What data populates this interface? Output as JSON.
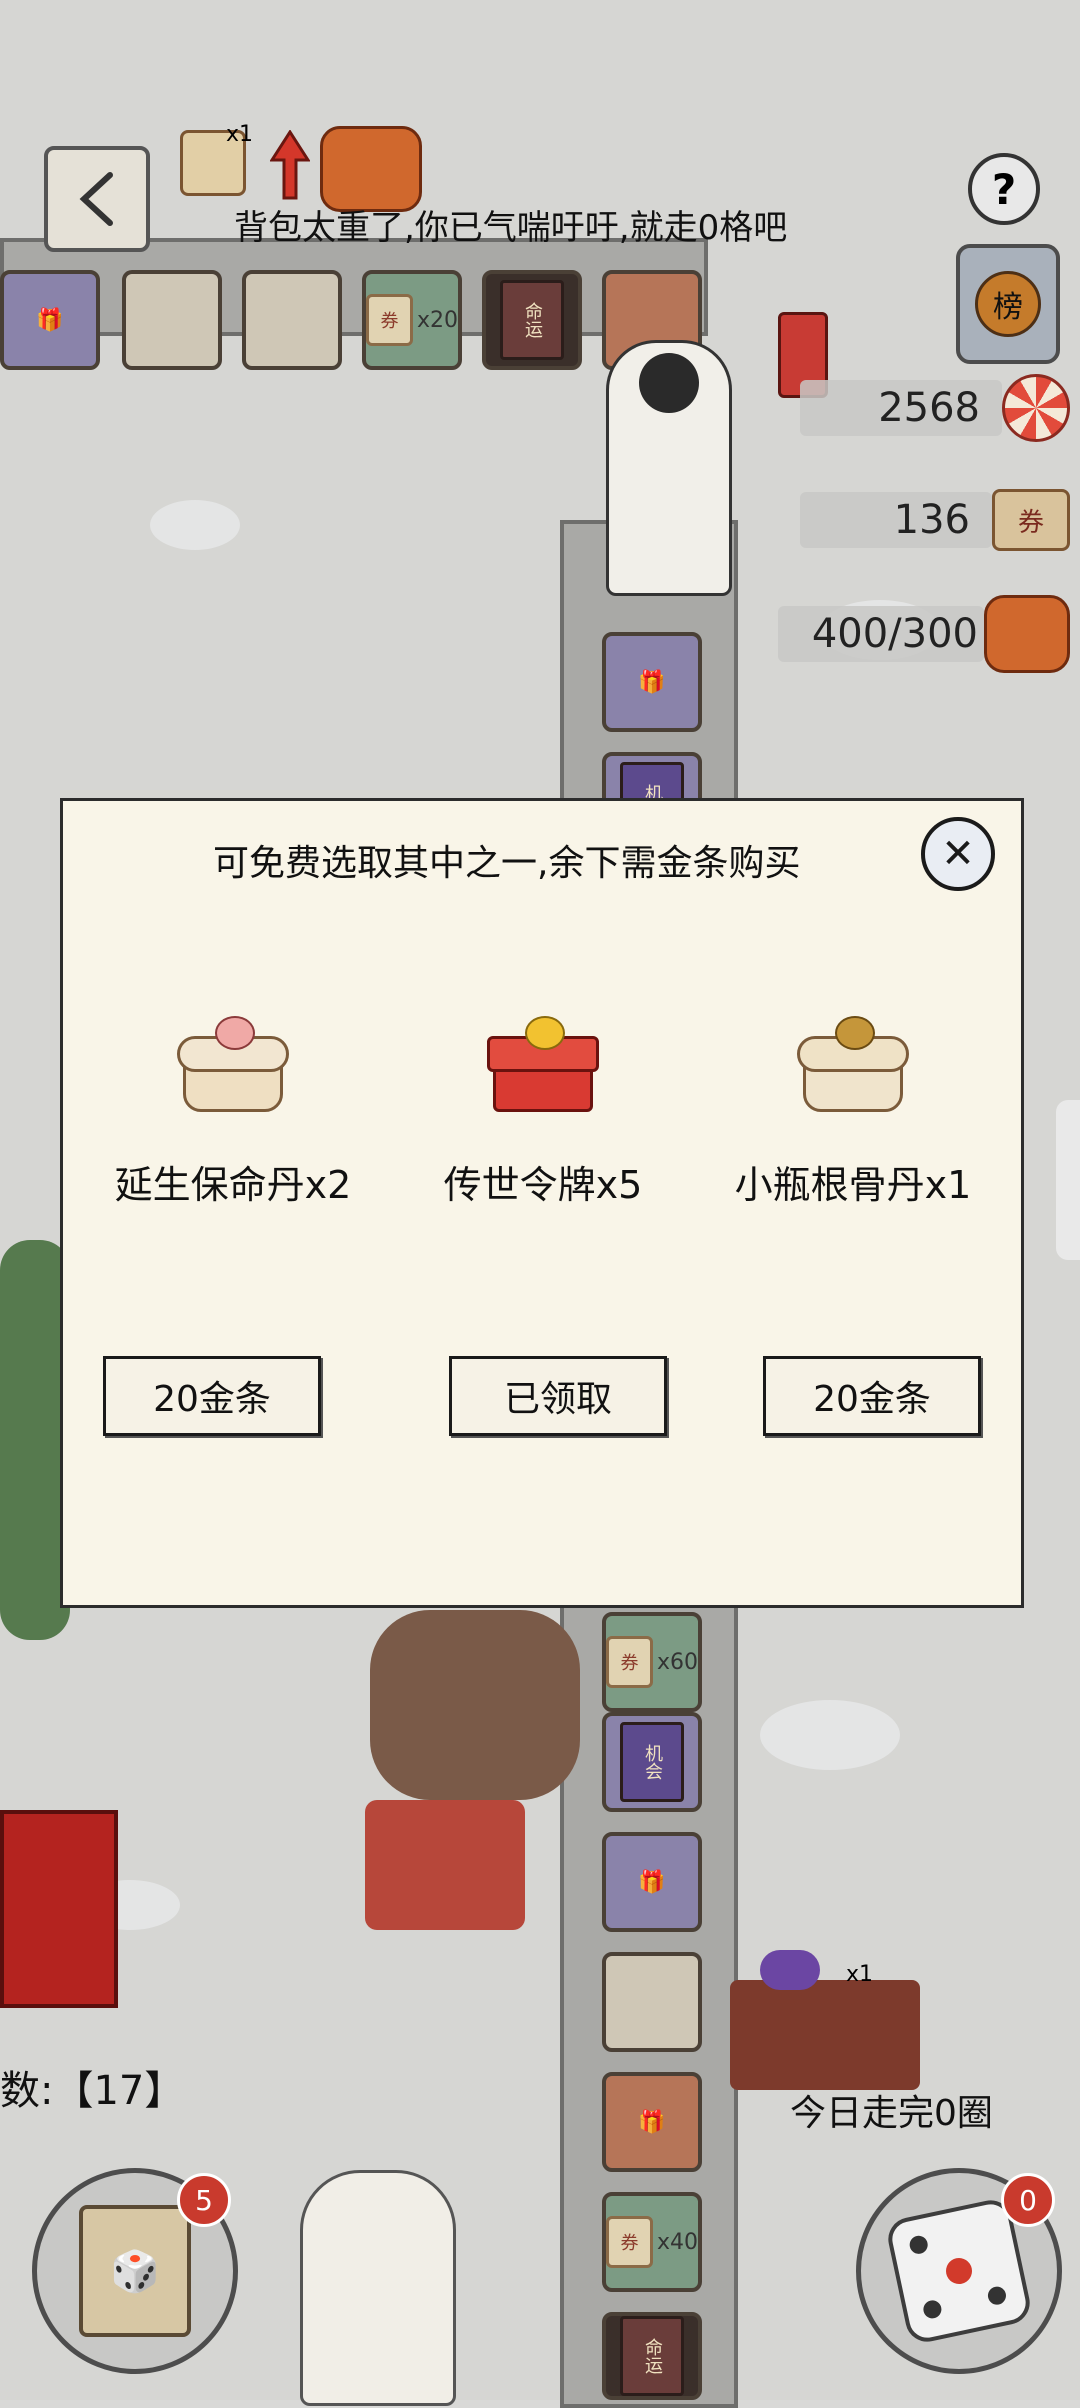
{
  "notice": "背包太重了,你已气喘吁吁,就走0格吧",
  "resources": {
    "lollipop_count": "2568",
    "ticket_count": "136",
    "backpack_load": "400/300"
  },
  "top_tiles": {
    "ticket_count": "x20",
    "book_text": "命运"
  },
  "board": {
    "tile_chance_text": "机会",
    "tile_ticket_60": "x60",
    "tile_ticket_40": "x40",
    "tile_fate_text": "命运",
    "candy_count": "x1",
    "ticket_glyph": "券",
    "top_bag_count": "x1"
  },
  "rank_glyph": "榜",
  "help_glyph": "?",
  "modal": {
    "title": "可免费选取其中之一,余下需金条购买",
    "close_glyph": "✕",
    "options": [
      {
        "label": "延生保命丹x2",
        "button": "20金条"
      },
      {
        "label": "传世令牌x5",
        "button": "已领取"
      },
      {
        "label": "小瓶根骨丹x1",
        "button": "20金条"
      }
    ]
  },
  "steps_text": "数:【17】",
  "today_text": "今日走完0圈",
  "cards_badge": "5",
  "dice_badge": "0",
  "colors": {
    "modal_bg": "#f9f5e8",
    "badge_red": "#c93a2d"
  }
}
